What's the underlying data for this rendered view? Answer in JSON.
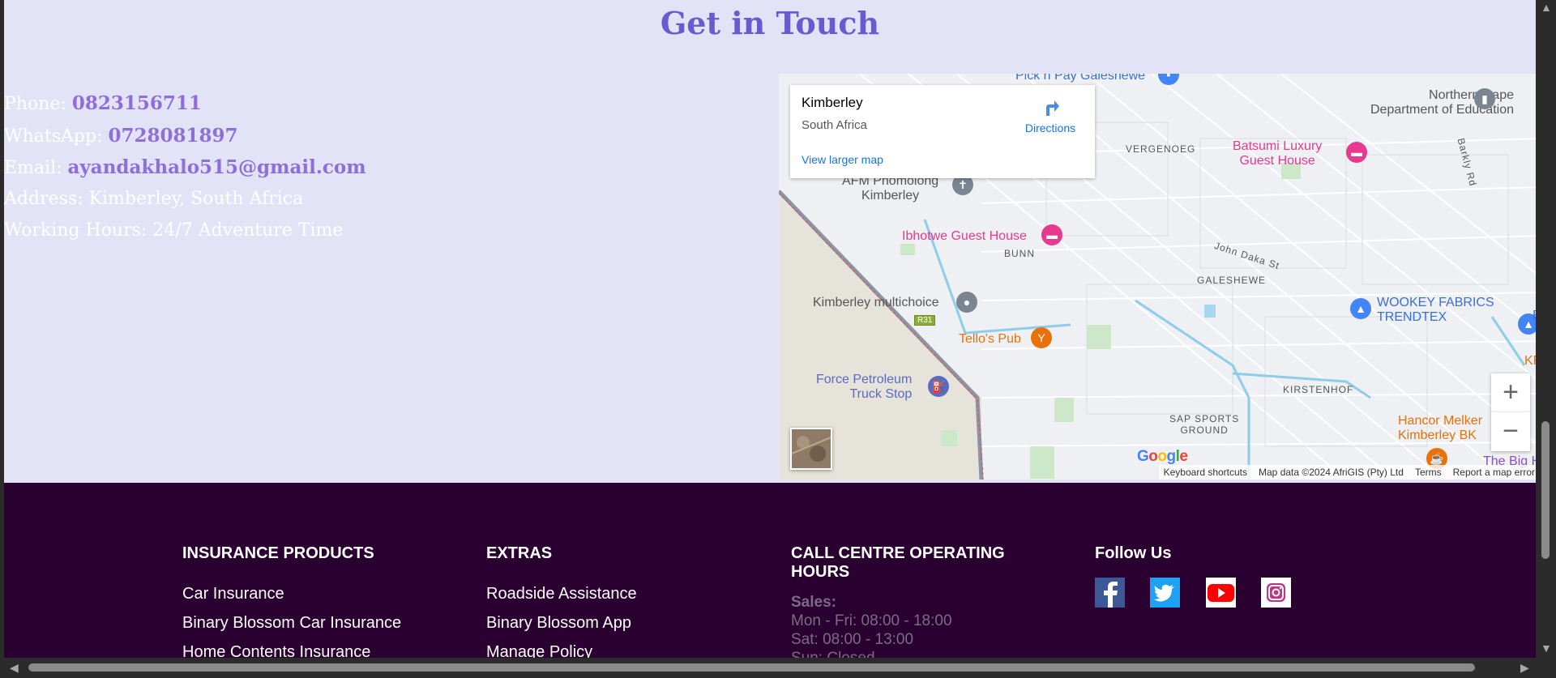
{
  "contact": {
    "title": "Get in Touch",
    "phone_label": "Phone:",
    "phone": "0823156711",
    "whatsapp_label": "WhatsApp:",
    "whatsapp": "0728081897",
    "email_label": "Email:",
    "email": "ayandakhalo515@gmail.com",
    "address": "Address: Kimberley, South Africa",
    "hours": "Working Hours: 24/7 Adventure Time"
  },
  "map": {
    "card_title": "Kimberley",
    "card_subtitle": "South Africa",
    "directions": "Directions",
    "view_larger": "View larger map",
    "places": {
      "top_partial": "Pick n Pay Galeshewe",
      "northern_cape_1": "Northern Cape",
      "northern_cape_2": "Department of Education",
      "vergenoeg": "VERGENOEG",
      "batsumi_1": "Batsumi Luxury",
      "batsumi_2": "Guest House",
      "barkly": "Barkly Rd",
      "afm_1": "AFM Phomolong",
      "afm_2": "Kimberley",
      "ibhotwe": "Ibhotwe Guest House",
      "bunn": "BUNN",
      "john_daka": "John Daka St",
      "galeshewe": "GALESHEWE",
      "multichoice": "Kimberley multichoice",
      "wookey_1": "WOOKEY FABRICS",
      "wookey_2": "TRENDTEX",
      "r31": "R31",
      "tellos": "Tello's Pub",
      "force_1": "Force Petroleum",
      "force_2": "Truck Stop",
      "kirstenhof": "KIRSTENHOF",
      "sap_1": "SAP SPORTS",
      "sap_2": "GROUND",
      "hancor_1": "Hancor Melker",
      "hancor_2": "Kimberley BK",
      "bighole": "The Big H",
      "kf": "KF",
      "b_edge": "B"
    },
    "google": "Google",
    "attribution": [
      "Keyboard shortcuts",
      "Map data ©2024 AfriGIS (Pty) Ltd",
      "Terms",
      "Report a map error"
    ],
    "zoom_in": "+",
    "zoom_out": "−"
  },
  "footer": {
    "col1": {
      "heading": "INSURANCE PRODUCTS",
      "links": [
        "Car Insurance",
        "Binary Blossom Car Insurance",
        "Home Contents Insurance"
      ]
    },
    "col2": {
      "heading": "EXTRAS",
      "links": [
        "Roadside Assistance",
        "Binary Blossom App",
        "Manage Policy"
      ]
    },
    "col3": {
      "heading": "CALL CENTRE OPERATING HOURS",
      "sales_label": "Sales:",
      "lines": [
        "Mon - Fri: 08:00 - 18:00",
        "Sat: 08:00 - 13:00",
        "Sun: Closed"
      ]
    },
    "col4": {
      "heading": "Follow Us",
      "icons": [
        "facebook-icon",
        "twitter-icon",
        "youtube-icon",
        "instagram-icon"
      ]
    }
  },
  "colors": {
    "accent": "#6a5acd",
    "page_bg": "#e3e3f8",
    "footer_bg": "#2a0030"
  }
}
